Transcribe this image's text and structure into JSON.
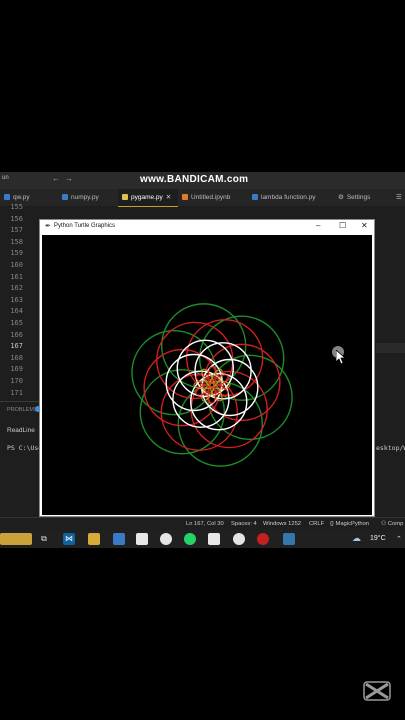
{
  "watermark": "www.BANDICAM.com",
  "titlebar": {
    "left_text": "un"
  },
  "tabs": [
    {
      "label": "qw.py",
      "active": false
    },
    {
      "label": "numpy.py",
      "active": false
    },
    {
      "label": "pygame.py",
      "active": true
    },
    {
      "label": "Untitled.ipynb",
      "active": false
    },
    {
      "label": "lambda function.py",
      "active": false
    },
    {
      "label": "Settings",
      "active": false
    }
  ],
  "line_numbers": [
    "155",
    "156",
    "157",
    "158",
    "159",
    "160",
    "161",
    "162",
    "163",
    "164",
    "165",
    "166",
    "167",
    "168",
    "169",
    "170",
    "171"
  ],
  "current_line": "167",
  "panel": {
    "label": "PROBLEMS",
    "readline": "ReadLine",
    "ps_left": "PS C:\\Use",
    "ps_right": "esktop/W"
  },
  "turtle_window": {
    "title": "Python Turtle Graphics",
    "minimize": "–",
    "maximize": "☐",
    "close": "✕"
  },
  "status": {
    "position": "Ln 167, Col 30",
    "spaces": "Spaces: 4",
    "encoding": "Windows 1252",
    "eol": "CRLF",
    "language": "MagicPython",
    "extra": "Comp"
  },
  "taskbar": {
    "temperature": "19°C"
  },
  "colors": {
    "accent_tab": "#c5a028",
    "vscode_blue": "#0078d4",
    "red": "#d42020",
    "green": "#1f8a2a"
  },
  "icons": [
    "search-icon",
    "back-arrow-icon",
    "forward-arrow-icon",
    "copilot-icon",
    "python-file-icon",
    "notebook-icon",
    "settings-icon",
    "windows-start-icon",
    "vscode-icon",
    "file-explorer-icon",
    "chrome-icon",
    "whatsapp-icon",
    "weather-icon",
    "capcut-icon"
  ]
}
